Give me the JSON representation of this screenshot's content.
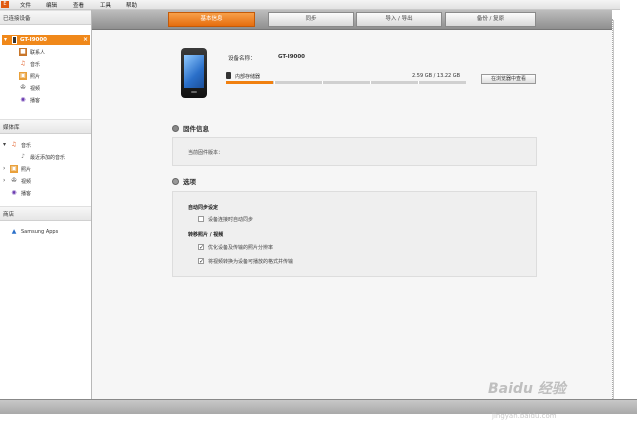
{
  "menu": {
    "logo": "E",
    "items": [
      "文件",
      "编辑",
      "查看",
      "工具",
      "帮助"
    ]
  },
  "sidebar": {
    "connected_header": "已连接设备",
    "device": {
      "name": "GT-I9000",
      "close": "×",
      "chev": "▾"
    },
    "device_items": [
      {
        "label": "联系人",
        "icon": "contacts-icon"
      },
      {
        "label": "音乐",
        "icon": "music-icon"
      },
      {
        "label": "照片",
        "icon": "photo-icon"
      },
      {
        "label": "视频",
        "icon": "video-icon"
      },
      {
        "label": "播客",
        "icon": "podcast-icon"
      }
    ],
    "library_header": "媒体库",
    "library_items": [
      {
        "label": "音乐",
        "icon": "music-icon",
        "chev": "▾"
      },
      {
        "label": "最近添加的音乐",
        "icon": "recent-music-icon",
        "chev": ""
      },
      {
        "label": "照片",
        "icon": "photo-icon",
        "chev": "›"
      },
      {
        "label": "视频",
        "icon": "video-icon",
        "chev": "›"
      },
      {
        "label": "播客",
        "icon": "podcast-icon",
        "chev": ""
      }
    ],
    "store_header": "商店",
    "store_items": [
      {
        "label": "Samsung Apps",
        "icon": "samsung-apps-icon"
      }
    ]
  },
  "tabs": [
    {
      "label": "基本信息",
      "active": true
    },
    {
      "label": "同步",
      "active": false
    },
    {
      "label": "导入 / 导出",
      "active": false
    },
    {
      "label": "备份 / 复原",
      "active": false
    }
  ],
  "device_info": {
    "name_label": "设备名称：",
    "name_value": "GT-I9000",
    "storage_label": "内部存储器",
    "storage_value": "2.59 GB / 13.22 GB",
    "storage_fraction": 0.196,
    "browse_button": "在浏览器中查看"
  },
  "firmware": {
    "title": "固件信息",
    "version_label": "当前固件版本："
  },
  "options": {
    "title": "选项",
    "autosync_header": "自动同步设定",
    "autosync_option": {
      "label": "设备连接时自动同步",
      "checked": false
    },
    "transfer_header": "转移照片 / 视频",
    "transfer_options": [
      {
        "label": "优化设备及传输的照片分辨率",
        "checked": true
      },
      {
        "label": "将视频转换为设备可播放的格式并传输",
        "checked": true
      }
    ]
  },
  "watermark": {
    "text": "Baidu 经验",
    "url": "jingyan.baidu.com"
  },
  "colors": {
    "accent": "#f0881a",
    "tab_active": "#e66d0e"
  }
}
